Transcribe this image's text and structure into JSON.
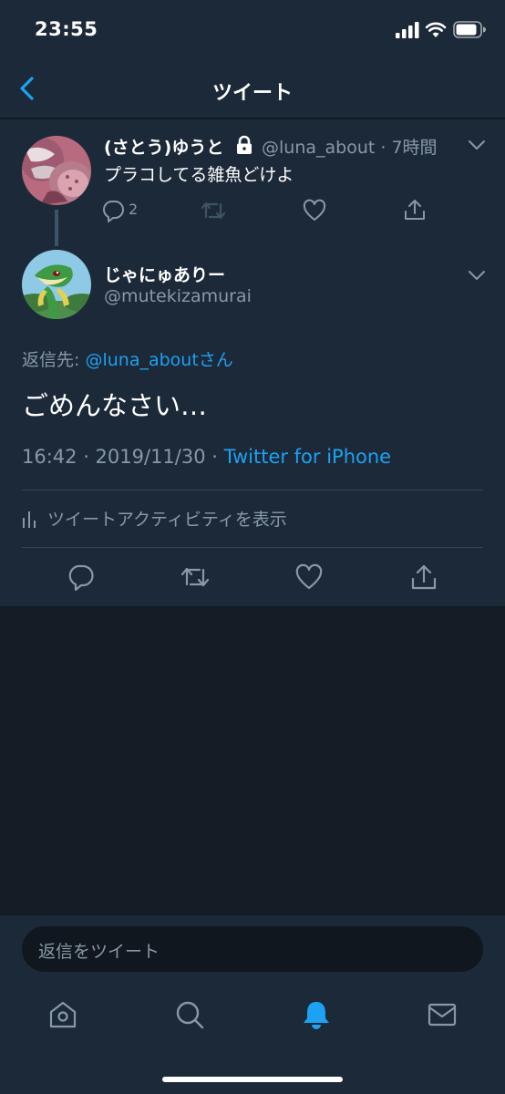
{
  "status_bar": {
    "time": "23:55"
  },
  "nav": {
    "title": "ツイート"
  },
  "parent_tweet": {
    "name": "(さとう)ゆうと",
    "handle": "@luna_about · 7時間",
    "text": "プラコしてる雑魚どけよ",
    "reply_count": "2"
  },
  "main_tweet": {
    "name": "じゃにゅありー",
    "handle": "@mutekizamurai",
    "reply_label": "返信先: ",
    "reply_mention": "@luna_about",
    "reply_suffix": "さん",
    "text": "ごめんなさい…",
    "timestamp": "16:42 · 2019/11/30 · ",
    "source": "Twitter for iPhone",
    "activity": "ツイートアクティビティを表示"
  },
  "reply_box": {
    "placeholder": "返信をツイート"
  },
  "colors": {
    "background": "#141d26",
    "panel": "#1c2938",
    "accent": "#1da1f2",
    "muted": "#8899a6"
  },
  "icons": [
    "back-icon",
    "lock-icon",
    "chevron-down-icon",
    "reply-icon",
    "retweet-icon",
    "like-icon",
    "share-icon",
    "activity-icon",
    "home-icon",
    "search-icon",
    "notifications-icon",
    "messages-icon"
  ]
}
